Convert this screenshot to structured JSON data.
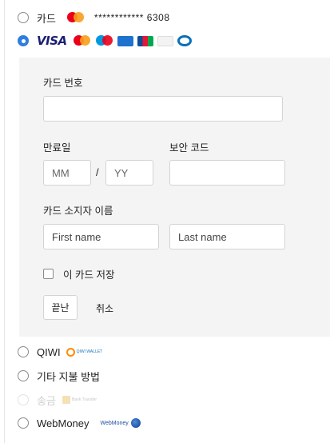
{
  "saved_card": {
    "label": "카드",
    "brand": "mastercard",
    "masked_number": "************ 6308"
  },
  "new_card": {
    "brands": [
      "VISA",
      "mastercard",
      "maestro",
      "AMEX",
      "JCB",
      "DISCOVER",
      "Diners"
    ],
    "visa_text": "VISA",
    "form": {
      "card_number_label": "카드 번호",
      "card_number_value": "",
      "expiry_label": "만료일",
      "expiry_month_placeholder": "MM",
      "expiry_separator": "/",
      "expiry_year_placeholder": "YY",
      "security_code_label": "보안 코드",
      "security_code_value": "",
      "holder_label": "카드 소지자 이름",
      "first_name_placeholder": "First name",
      "last_name_placeholder": "Last name",
      "save_card_label": "이 카드 저장",
      "save_card_checked": false,
      "done_button": "끝난",
      "cancel_link": "취소"
    }
  },
  "methods": [
    {
      "label": "QIWI",
      "logo": "qiwi-wallet-logo",
      "logo_text": "QIWI WALLET",
      "disabled": false
    },
    {
      "label": "기타 지불 방법",
      "disabled": false
    },
    {
      "label": "송금",
      "logo": "bank-transfer-logo",
      "logo_text": "Bank Transfer",
      "disabled": true
    },
    {
      "label": "WebMoney",
      "logo": "webmoney-logo",
      "logo_text": "WebMoney",
      "disabled": false
    }
  ],
  "colors": {
    "accent": "#2f7de1",
    "panel_bg": "#f4f4f4"
  }
}
